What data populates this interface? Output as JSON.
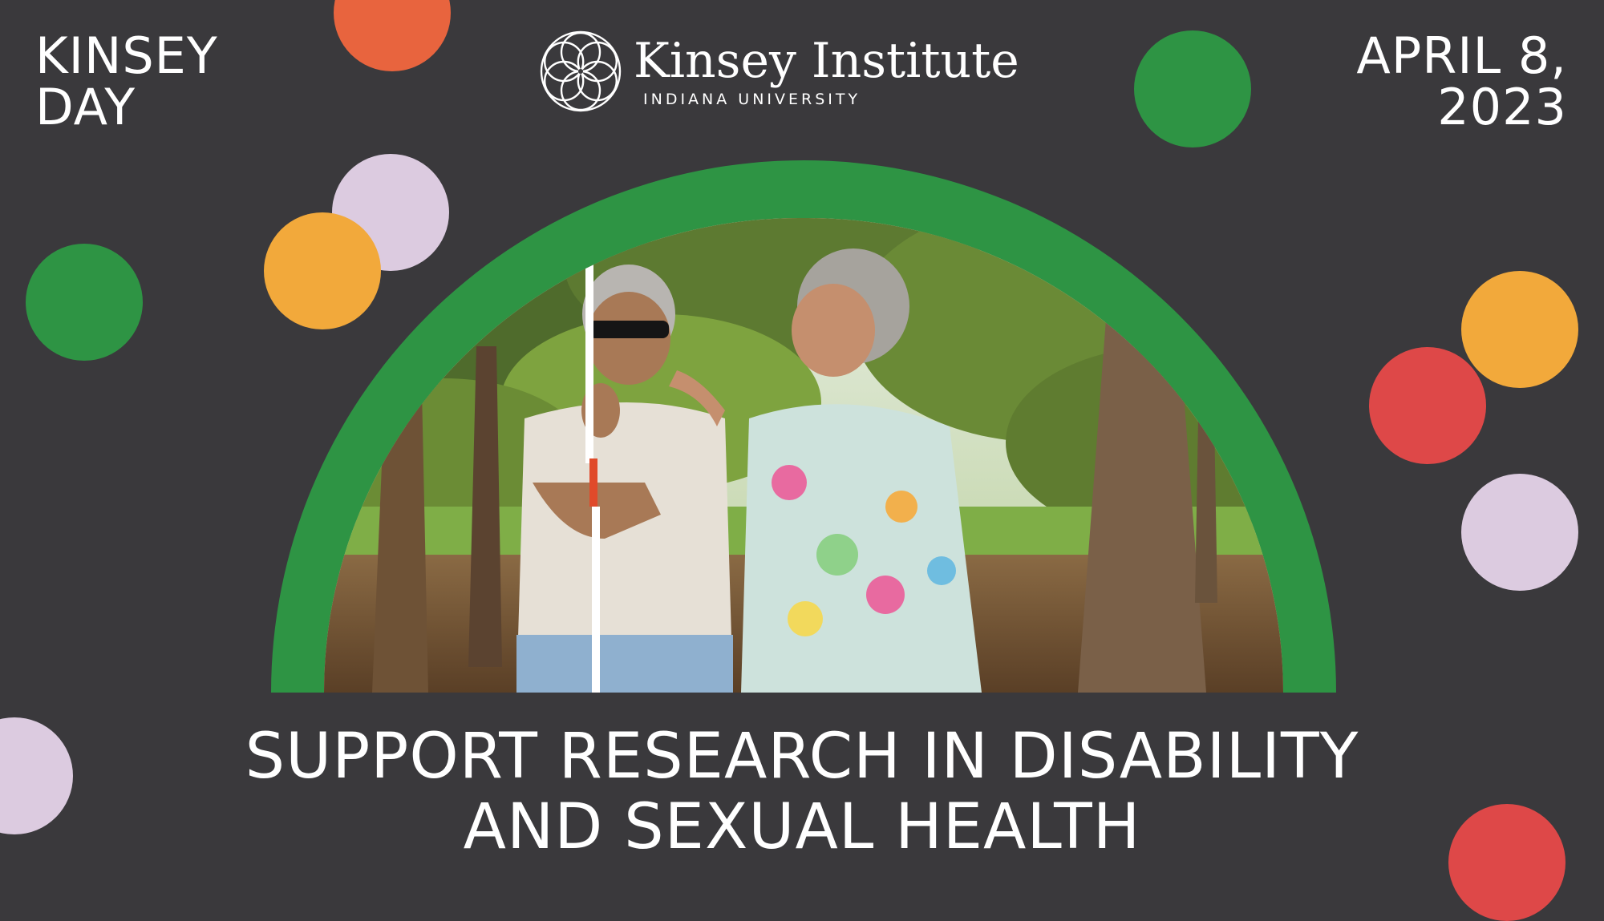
{
  "header": {
    "left_line1": "KINSEY",
    "left_line2": "DAY",
    "date_line1": "APRIL 8,",
    "date_line2": "2023"
  },
  "logo": {
    "name": "Kinsey Institute",
    "subtitle": "INDIANA UNIVERSITY",
    "icon": "flower-of-life-icon"
  },
  "headline": {
    "line1": "SUPPORT RESEARCH IN DISABILITY",
    "line2": "AND SEXUAL HEALTH"
  },
  "photo": {
    "description_icon": "couple-photo"
  },
  "colors": {
    "background": "#3a393c",
    "green": "#2e9444",
    "orange": "#e8643e",
    "lilac": "#dccbe0",
    "yellow": "#f2a93b",
    "red": "#de4848"
  }
}
